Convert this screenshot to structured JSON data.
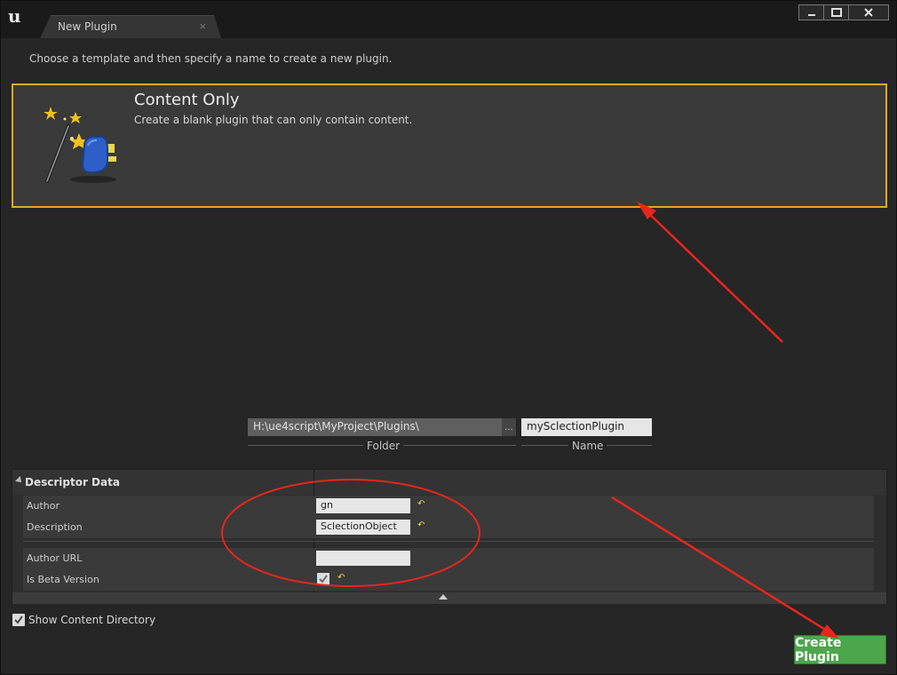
{
  "window": {
    "tab_title": "New Plugin",
    "tab_close": "×"
  },
  "instruction": "Choose a template and then specify a name to create a new plugin.",
  "template": {
    "title": "Content Only",
    "description": "Create a blank plugin that can only contain content.",
    "icon": "magic-wand-plugin-icon"
  },
  "paths": {
    "folder_value": "H:\\ue4script\\MyProject\\Plugins\\",
    "browse_label": "...",
    "name_value": "mySclectionPlugin",
    "folder_caption": "Folder",
    "name_caption": "Name"
  },
  "descriptor": {
    "header": "Descriptor Data",
    "rows": [
      {
        "label": "Author",
        "value": "gn"
      },
      {
        "label": "Description",
        "value": "SclectionObject"
      },
      {
        "label": "Author URL",
        "value": ""
      },
      {
        "label": "Is Beta Version",
        "checked": true
      }
    ]
  },
  "show_content_directory": {
    "label": "Show Content Directory",
    "checked": true
  },
  "create_button": "Create Plugin",
  "colors": {
    "accent_border": "#e5a823",
    "create_button": "#4ca64c",
    "annotation": "#e8261c"
  }
}
